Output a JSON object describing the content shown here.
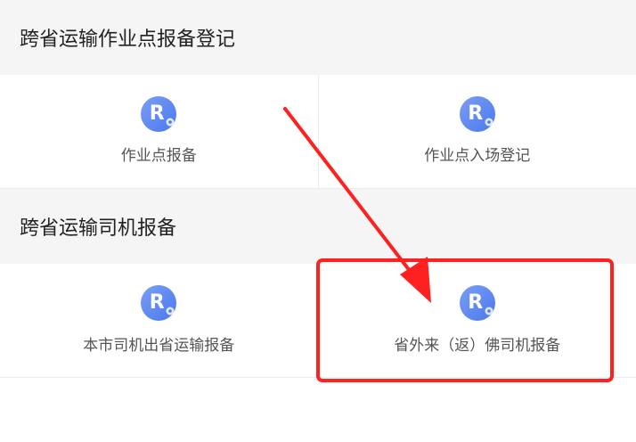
{
  "sections": [
    {
      "title": "跨省运输作业点报备登记",
      "items": [
        {
          "label": "作业点报备",
          "icon": "app-r-location-icon"
        },
        {
          "label": "作业点入场登记",
          "icon": "app-r-location-icon"
        }
      ]
    },
    {
      "title": "跨省运输司机报备",
      "items": [
        {
          "label": "本市司机出省运输报备",
          "icon": "app-r-location-icon"
        },
        {
          "label": "省外来（返）佛司机报备",
          "icon": "app-r-location-icon"
        }
      ]
    }
  ],
  "icon_letter": "R",
  "colors": {
    "accent_blue": "#5b86f0",
    "annotation_red": "#ff2020",
    "header_bg": "#f5f5f5"
  }
}
